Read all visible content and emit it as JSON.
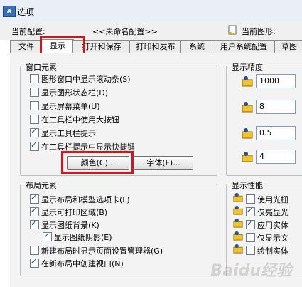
{
  "window": {
    "title": "选项",
    "icon": "autocad-app-icon"
  },
  "profile": {
    "label": "当前配置:",
    "value": "<<未命名配置>>"
  },
  "drawing": {
    "label": "当前图形:"
  },
  "tabs": [
    "文件",
    "显示",
    "打开和保存",
    "打印和发布",
    "系统",
    "用户系统配置",
    "草图"
  ],
  "active_tab": "显示",
  "window_elements": {
    "title": "窗口元素",
    "items": [
      {
        "label": "图形窗口中显示滚动条(S)",
        "checked": false
      },
      {
        "label": "显示图形状态栏(D)",
        "checked": false
      },
      {
        "label": "显示屏幕菜单(U)",
        "checked": false
      },
      {
        "label": "在工具栏中使用大按钮",
        "checked": false
      },
      {
        "label": "显示工具栏提示",
        "checked": true
      },
      {
        "label": "在工具栏提示中显示快捷键",
        "checked": true
      }
    ],
    "colors_button": "颜色(C)...",
    "fonts_button": "字体(F)..."
  },
  "display_resolution": {
    "title": "显示精度",
    "values": [
      "1000",
      "8",
      "0.5",
      "4"
    ]
  },
  "layout_elements": {
    "title": "布局元素",
    "items": [
      {
        "label": "显示布局和模型选项卡(L)",
        "checked": true
      },
      {
        "label": "显示可打印区域(B)",
        "checked": true
      },
      {
        "label": "显示图纸背景(K)",
        "checked": true
      },
      {
        "label": "显示图纸阴影(E)",
        "checked": true
      },
      {
        "label": "新建布局时显示页面设置管理器(G)",
        "checked": false
      },
      {
        "label": "在新布局中创建视口(N)",
        "checked": true
      }
    ]
  },
  "display_performance": {
    "title": "显示性能",
    "items": [
      {
        "label": "使用光栅",
        "checked": false
      },
      {
        "label": "仅亮显光",
        "checked": true
      },
      {
        "label": "应用实体",
        "checked": true
      },
      {
        "label": "仅显示文",
        "checked": false
      },
      {
        "label": "绘制实体",
        "checked": false
      }
    ]
  },
  "watermark": "Baidu经验",
  "colors": {
    "highlight_box": "#d8141b",
    "check": "#1f3f7a"
  }
}
